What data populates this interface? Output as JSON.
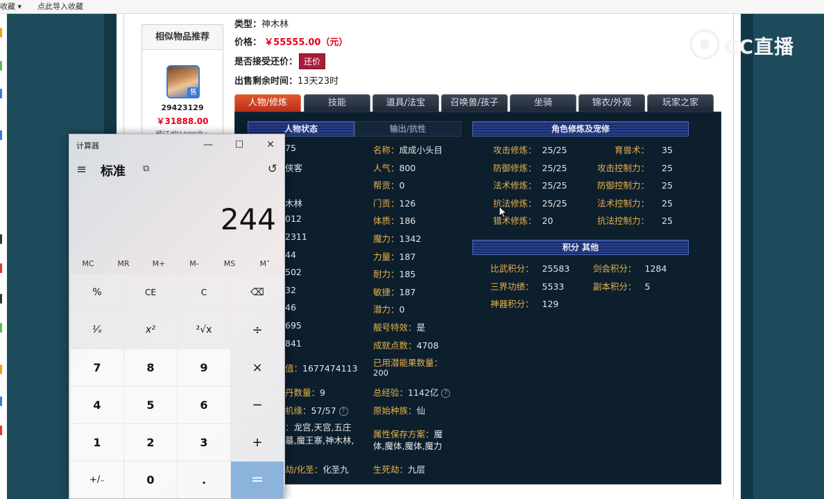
{
  "browser": {
    "bookmarks_label": "收藏",
    "import_label": "点此导入收藏"
  },
  "listing": {
    "type_label": "类型：",
    "type_value": "神木林",
    "price_label": "价格：",
    "price_value": "￥55555.00（元）",
    "haggle_label": "是否接受还价：",
    "haggle_button": "还价",
    "remaining_label": "出售剩余时间：",
    "remaining_value": "13天23时"
  },
  "similar": {
    "header": "相似物品推荐",
    "sold_badge": "售",
    "item_id": "29423129",
    "item_price": "￥31888.00",
    "note": "预订/约1000余+"
  },
  "tabs": [
    {
      "label": "人物/修炼",
      "active": true
    },
    {
      "label": "技能",
      "active": false
    },
    {
      "label": "道具/法宝",
      "active": false
    },
    {
      "label": "召唤兽/孩子",
      "active": false
    },
    {
      "label": "坐骑",
      "active": false
    },
    {
      "label": "锦衣/外观",
      "active": false
    },
    {
      "label": "玩家之家",
      "active": false
    }
  ],
  "panel": {
    "left_headers": [
      "人物状态",
      "输出/抗性"
    ],
    "col1_partial": [
      "75",
      "侠客",
      "",
      "木林",
      "012",
      "2311",
      "44",
      "502",
      "32",
      "46",
      "695",
      "841"
    ],
    "col1_rows": [
      {
        "label": "值：",
        "value": "1677474113"
      },
      {
        "label": "丹数量：",
        "value": "9"
      },
      {
        "label": "机缘：",
        "value": "57/57"
      },
      {
        "label": "：",
        "value": "龙宫,天宫,五庄"
      },
      {
        "label": "",
        "value": "墓,魔王寨,神木林,"
      },
      {
        "label": "劫/化圣：",
        "value": "化圣九"
      }
    ],
    "col2_rows": [
      {
        "label": "名称：",
        "value": "成成小头目"
      },
      {
        "label": "人气：",
        "value": "800"
      },
      {
        "label": "帮贡：",
        "value": "0"
      },
      {
        "label": "门贡：",
        "value": "126"
      },
      {
        "label": "体质：",
        "value": "186"
      },
      {
        "label": "魔力：",
        "value": "1342"
      },
      {
        "label": "力量：",
        "value": "187"
      },
      {
        "label": "耐力：",
        "value": "185"
      },
      {
        "label": "敏捷：",
        "value": "187"
      },
      {
        "label": "潜力：",
        "value": "0"
      },
      {
        "label": "靓号特效：",
        "value": "是"
      },
      {
        "label": "成就点数：",
        "value": "4708"
      },
      {
        "label": "已用潜能果数量：",
        "value": "200"
      },
      {
        "label": "总经验：",
        "value": "1142亿"
      },
      {
        "label": "原始种族：",
        "value": "仙"
      },
      {
        "label": "属性保存方案：",
        "value": "魔"
      },
      {
        "label": "",
        "value": "体,魔体,魔体,魔力"
      },
      {
        "label": "生死劫：",
        "value": "九层"
      }
    ],
    "cultivation_header": "角色修炼及宠修",
    "cultivation_left": [
      {
        "label": "攻击修炼：",
        "value": "25/25"
      },
      {
        "label": "防御修炼：",
        "value": "25/25"
      },
      {
        "label": "法术修炼：",
        "value": "25/25"
      },
      {
        "label": "抗法修炼：",
        "value": "25/25"
      },
      {
        "label": "猎术修炼：",
        "value": "20"
      }
    ],
    "cultivation_right": [
      {
        "label": "育兽术：",
        "value": "35"
      },
      {
        "label": "攻击控制力：",
        "value": "25"
      },
      {
        "label": "防御控制力：",
        "value": "25"
      },
      {
        "label": "法术控制力：",
        "value": "25"
      },
      {
        "label": "抗法控制力：",
        "value": "25"
      }
    ],
    "points_header": "积分 其他",
    "points_left": [
      {
        "label": "比武积分：",
        "value": "25583"
      },
      {
        "label": "三界功绩：",
        "value": "5533"
      },
      {
        "label": "神器积分：",
        "value": "129"
      }
    ],
    "points_right": [
      {
        "label": "剑会积分：",
        "value": "1284"
      },
      {
        "label": "副本积分：",
        "value": "5"
      }
    ]
  },
  "calculator": {
    "title": "计算器",
    "minimize": "—",
    "maximize": "☐",
    "close": "✕",
    "menu_icon": "≡",
    "mode": "标准",
    "keep_on_top_icon": "⧉",
    "history_icon": "↺",
    "display": "244",
    "memory": [
      "MC",
      "MR",
      "M+",
      "M-",
      "MS",
      "M˅"
    ],
    "keys": [
      [
        "%",
        "CE",
        "C",
        "⌫"
      ],
      [
        "¹⁄ₓ",
        "x²",
        "²√x",
        "÷"
      ],
      [
        "7",
        "8",
        "9",
        "×"
      ],
      [
        "4",
        "5",
        "6",
        "−"
      ],
      [
        "1",
        "2",
        "3",
        "+"
      ],
      [
        "+/₋",
        "0",
        ".",
        "="
      ]
    ]
  },
  "overlay": {
    "brand": "CC直播"
  }
}
